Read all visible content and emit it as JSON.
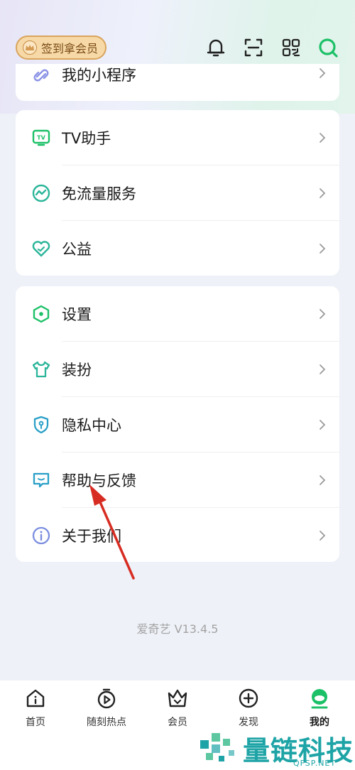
{
  "header": {
    "signin_label": "签到拿会员",
    "icons": [
      "bell-icon",
      "scan-icon",
      "qr-code-icon",
      "search-icon"
    ]
  },
  "cards": [
    {
      "items": [
        {
          "label": "我的小程序",
          "icon": "mini-program-icon"
        }
      ]
    },
    {
      "items": [
        {
          "label": "TV助手",
          "icon": "tv-icon"
        },
        {
          "label": "免流量服务",
          "icon": "data-free-icon"
        },
        {
          "label": "公益",
          "icon": "heart-icon"
        }
      ]
    },
    {
      "items": [
        {
          "label": "设置",
          "icon": "settings-hexagon-icon"
        },
        {
          "label": "装扮",
          "icon": "tshirt-icon"
        },
        {
          "label": "隐私中心",
          "icon": "privacy-shield-icon"
        },
        {
          "label": "帮助与反馈",
          "icon": "help-chat-icon"
        },
        {
          "label": "关于我们",
          "icon": "info-icon"
        }
      ]
    }
  ],
  "version": "爱奇艺 V13.4.5",
  "tabbar": {
    "tabs": [
      {
        "label": "首页",
        "icon": "home-icon"
      },
      {
        "label": "随刻热点",
        "icon": "play-timer-icon"
      },
      {
        "label": "会员",
        "icon": "vip-crown-icon"
      },
      {
        "label": "发现",
        "icon": "discover-plus-icon"
      },
      {
        "label": "我的",
        "icon": "profile-icon"
      }
    ],
    "active": "我的"
  },
  "watermark": {
    "text": "量链科技",
    "sub": "QFSP.NET"
  },
  "colors": {
    "accent": "#1cc067",
    "icon_teal": "#2bb59a",
    "background": "#eef1f7"
  }
}
